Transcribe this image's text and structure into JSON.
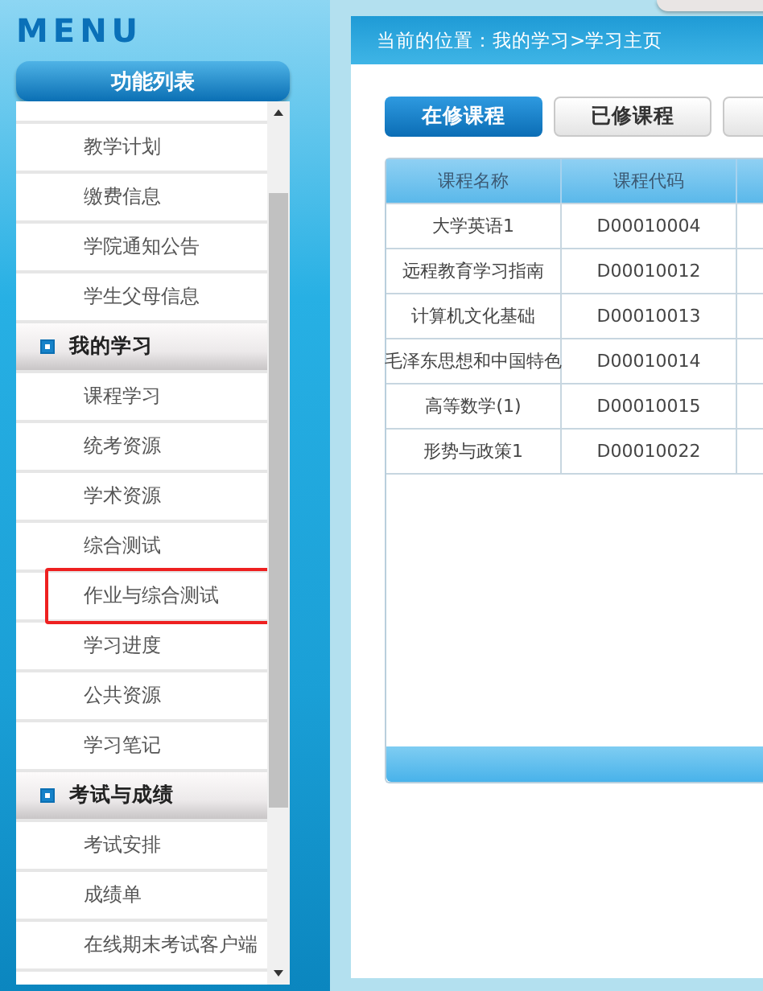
{
  "sidebar": {
    "logo": "MENU",
    "header": "功能列表",
    "items": [
      {
        "kind": "link",
        "label": "教学计划",
        "highlighted": false
      },
      {
        "kind": "link",
        "label": "缴费信息",
        "highlighted": false
      },
      {
        "kind": "link",
        "label": "学院通知公告",
        "highlighted": false
      },
      {
        "kind": "link",
        "label": "学生父母信息",
        "highlighted": false
      },
      {
        "kind": "section",
        "label": "我的学习",
        "highlighted": false
      },
      {
        "kind": "link",
        "label": "课程学习",
        "highlighted": false
      },
      {
        "kind": "link",
        "label": "统考资源",
        "highlighted": false
      },
      {
        "kind": "link",
        "label": "学术资源",
        "highlighted": false
      },
      {
        "kind": "link",
        "label": "综合测试",
        "highlighted": false
      },
      {
        "kind": "link",
        "label": "作业与综合测试",
        "highlighted": true
      },
      {
        "kind": "link",
        "label": "学习进度",
        "highlighted": false
      },
      {
        "kind": "link",
        "label": "公共资源",
        "highlighted": false
      },
      {
        "kind": "link",
        "label": "学习笔记",
        "highlighted": false
      },
      {
        "kind": "section",
        "label": "考试与成绩",
        "highlighted": false
      },
      {
        "kind": "link",
        "label": "考试安排",
        "highlighted": false
      },
      {
        "kind": "link",
        "label": "成绩单",
        "highlighted": false
      },
      {
        "kind": "link",
        "label": "在线期末考试客户端",
        "highlighted": false
      }
    ]
  },
  "breadcrumb": "当前的位置：我的学习>学习主页",
  "tabs": [
    {
      "label": "在修课程",
      "selected": true
    },
    {
      "label": "已修课程",
      "selected": false
    },
    {
      "selected": false
    }
  ],
  "table": {
    "columns": [
      "课程名称",
      "课程代码"
    ],
    "rows": [
      [
        "大学英语1",
        "D00010004"
      ],
      [
        "远程教育学习指南",
        "D00010012"
      ],
      [
        "计算机文化基础",
        "D00010013"
      ],
      [
        "毛泽东思想和中国特色",
        "D00010014"
      ],
      [
        "高等数学(1)",
        "D00010015"
      ],
      [
        "形势与政策1",
        "D00010022"
      ]
    ]
  }
}
